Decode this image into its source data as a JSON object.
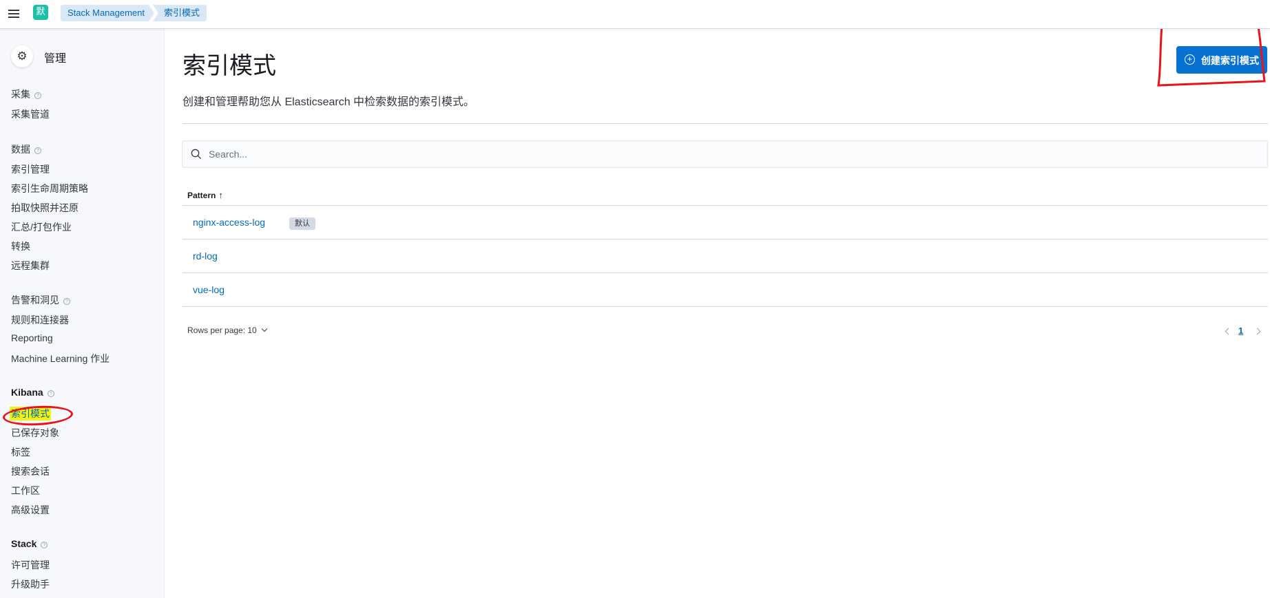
{
  "header": {
    "space_initial": "默",
    "breadcrumbs": [
      "Stack Management",
      "索引模式"
    ]
  },
  "sidebar": {
    "title": "管理",
    "groups": [
      {
        "title": "采集",
        "items": [
          "采集管道"
        ]
      },
      {
        "title": "数据",
        "items": [
          "索引管理",
          "索引生命周期策略",
          "拍取快照并还原",
          "汇总/打包作业",
          "转换",
          "远程集群"
        ]
      },
      {
        "title": "告警和洞见",
        "items": [
          "规则和连接器",
          "Reporting",
          "Machine Learning 作业"
        ]
      },
      {
        "title": "Kibana",
        "items": [
          "索引模式",
          "已保存对象",
          "标签",
          "搜索会话",
          "工作区",
          "高级设置"
        ]
      },
      {
        "title": "Stack",
        "items": [
          "许可管理",
          "升级助手"
        ]
      }
    ],
    "active_item": "索引模式"
  },
  "main": {
    "title": "索引模式",
    "description": "创建和管理帮助您从 Elasticsearch 中检索数据的索引模式。",
    "create_button": "创建索引模式",
    "search_placeholder": "Search...",
    "column_header": "Pattern",
    "rows": [
      {
        "pattern": "nginx-access-log",
        "badge": "默认"
      },
      {
        "pattern": "rd-log"
      },
      {
        "pattern": "vue-log"
      }
    ],
    "rows_per_page": "Rows per page: 10",
    "current_page": "1"
  },
  "colors": {
    "primary": "#0771d2",
    "link": "#006bb8",
    "highlight": "#f3f310",
    "annotation": "#e8141c"
  }
}
